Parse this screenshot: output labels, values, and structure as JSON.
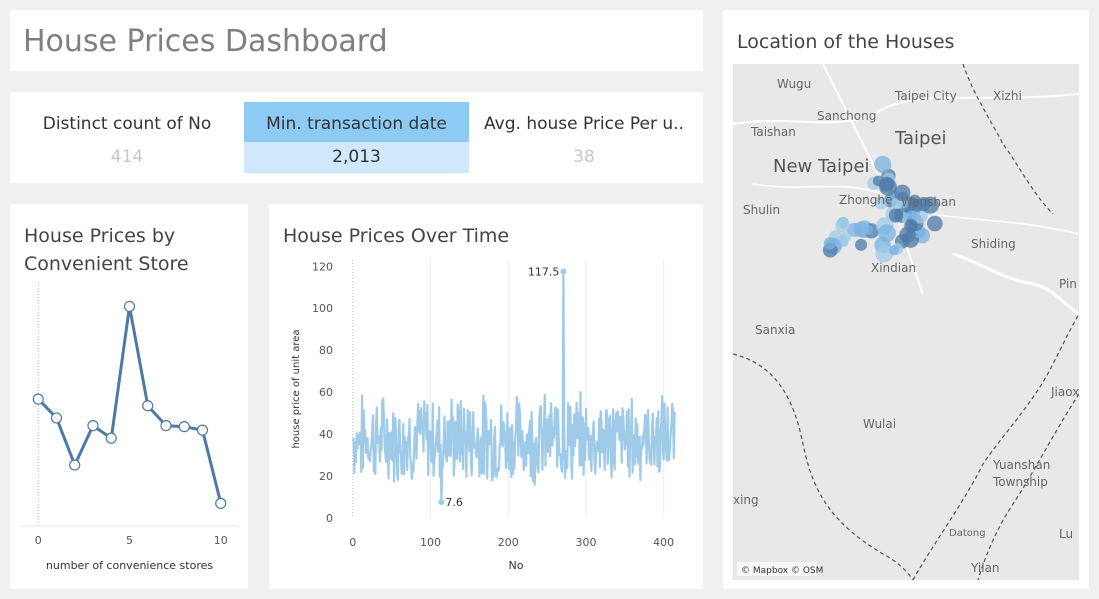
{
  "dashboard": {
    "title": "House Prices Dashboard"
  },
  "kpis": [
    {
      "label": "Distinct count of No",
      "value": "414"
    },
    {
      "label": "Min.  transaction date",
      "value": "2,013"
    },
    {
      "label": "Avg.  house Price Per u..",
      "value": "38"
    }
  ],
  "colors": {
    "line_dark": "#4e79a7",
    "line_light": "#a0cbe8",
    "highlight": "#8dcbf5",
    "highlight_light": "#cfe8fb"
  },
  "chart_data": [
    {
      "type": "line",
      "title": "House Prices by Convenient Store",
      "xlabel": "number of convenience stores",
      "ylabel": "",
      "x": [
        0,
        1,
        2,
        3,
        4,
        5,
        6,
        7,
        8,
        9,
        10
      ],
      "y": [
        41.4,
        36.0,
        22.5,
        33.8,
        30.2,
        68.0,
        39.5,
        33.8,
        33.5,
        32.5,
        11.5
      ],
      "xlim": [
        -1,
        11
      ],
      "ylim": [
        5,
        75
      ],
      "xticks": [
        "0",
        "5",
        "10"
      ],
      "markers": true
    },
    {
      "type": "line",
      "title": "House Prices Over Time",
      "xlabel": "No",
      "ylabel": "house price of unit area",
      "x_range": [
        1,
        414
      ],
      "n_points": 414,
      "xlim": [
        -10,
        430
      ],
      "ylim": [
        0,
        123
      ],
      "xticks": [
        "0",
        "100",
        "200",
        "300",
        "400"
      ],
      "yticks": [
        "0",
        "20",
        "40",
        "60",
        "80",
        "100",
        "120"
      ],
      "annotations": [
        {
          "x": 271,
          "y": 117.5,
          "label": "117.5"
        },
        {
          "x": 114,
          "y": 7.6,
          "label": "7.6"
        }
      ],
      "grid": true
    }
  ],
  "map": {
    "title": "Location of the Houses",
    "attribution": "© Mapbox © OSM",
    "places": [
      {
        "name": "Wugu",
        "size": "sm"
      },
      {
        "name": "Taipei City",
        "size": "sm"
      },
      {
        "name": "Xizhi",
        "size": "sm"
      },
      {
        "name": "Sanchong",
        "size": "sm"
      },
      {
        "name": "Taishan",
        "size": "sm"
      },
      {
        "name": "Taipei",
        "size": "lg"
      },
      {
        "name": "New Taipei",
        "size": "lg"
      },
      {
        "name": "Zhonghe",
        "size": "sm"
      },
      {
        "name": "Wenshan",
        "size": "sm"
      },
      {
        "name": "Shulin",
        "size": "sm"
      },
      {
        "name": "Shiding",
        "size": "sm"
      },
      {
        "name": "Xindian",
        "size": "sm"
      },
      {
        "name": "Pin",
        "size": "sm"
      },
      {
        "name": "Sanxia",
        "size": "sm"
      },
      {
        "name": "Jiaox",
        "size": "sm"
      },
      {
        "name": "Wulai",
        "size": "sm"
      },
      {
        "name": "Yuanshan",
        "size": "sm"
      },
      {
        "name": "Township",
        "size": "sm"
      },
      {
        "name": "xing",
        "size": "sm"
      },
      {
        "name": "Datong",
        "size": "xs"
      },
      {
        "name": "Lu",
        "size": "sm"
      },
      {
        "name": "Yilan",
        "size": "sm"
      }
    ]
  }
}
